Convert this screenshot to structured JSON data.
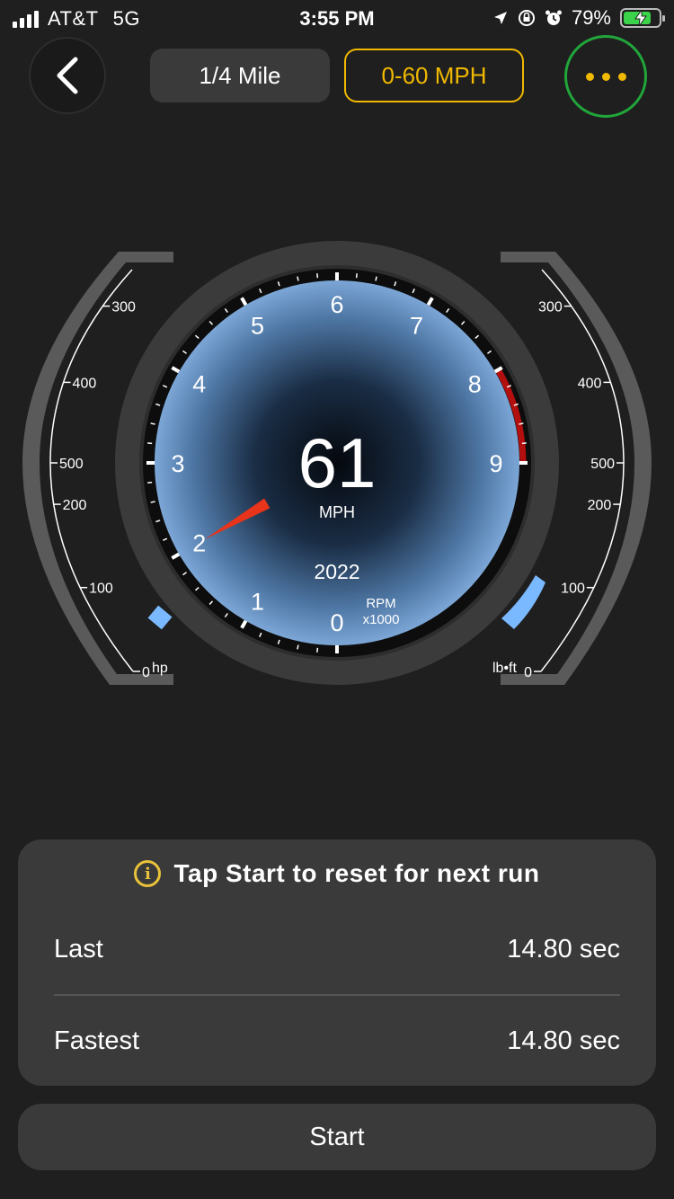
{
  "status_bar": {
    "carrier": "AT&T",
    "network": "5G",
    "time": "3:55 PM",
    "battery_percent": "79%",
    "battery_level": 0.79
  },
  "header": {
    "back_icon": "chevron-left-icon",
    "tabs": [
      {
        "label": "1/4 Mile",
        "selected": false
      },
      {
        "label": "0-60 MPH",
        "selected": true
      }
    ],
    "more_icon": "ellipsis-icon",
    "accent_color": "#f0b800"
  },
  "gauge": {
    "speed": "61",
    "speed_unit": "MPH",
    "year": "2022",
    "rpm_label": "RPM",
    "rpm_multiplier": "x1000",
    "rpm_ticks": [
      "0",
      "1",
      "2",
      "3",
      "4",
      "5",
      "6",
      "7",
      "8",
      "9"
    ],
    "rpm_value": 2,
    "redline_from": 8,
    "left_scale": {
      "unit": "hp",
      "ticks": [
        "0",
        "100",
        "200",
        "300",
        "400",
        "500"
      ],
      "level": 0.02
    },
    "right_scale": {
      "unit": "lb•ft",
      "ticks": [
        "0",
        "100",
        "200",
        "300",
        "400",
        "500"
      ],
      "level": 0.12
    },
    "needle_color": "#e8341a",
    "redline_color": "#b40f0f",
    "bar_color": "#7ab9ff"
  },
  "results": {
    "info_icon": "info-icon",
    "message": "Tap Start to reset for next run",
    "last_label": "Last",
    "last_value": "14.80 sec",
    "fastest_label": "Fastest",
    "fastest_value": "14.80 sec"
  },
  "start_button": {
    "label": "Start"
  }
}
